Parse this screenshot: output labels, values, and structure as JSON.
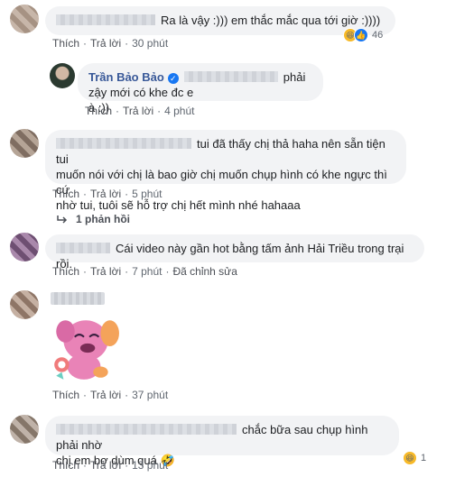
{
  "actions": {
    "like": "Thích",
    "reply": "Trả lời",
    "edited": "Đã chỉnh sửa"
  },
  "comments": [
    {
      "text": "Ra là vậy :))) em thắc mắc qua tới giờ :))))",
      "time": "30 phút",
      "reaction_count": "46"
    },
    {
      "author": "Trần Bảo Bảo",
      "text_line1": "phải zậy mới có khe đc e",
      "text_line2": "à :))",
      "time": "4 phút"
    },
    {
      "text_line1": "tui đã thấy chị thả haha nên sẵn tiện tui",
      "text_line2": "muốn nói với chị là bao giờ chị muốn chụp hình có khe ngực thì cứ",
      "text_line3": "nhờ tui, tuôi sẽ hỗ trợ chị hết mình nhé hahaaa",
      "time": "5 phút",
      "replies": "1 phản hồi"
    },
    {
      "text": "Cái video này gần hot bằng tấm ảnh Hải Triều trong trại rồi.",
      "time": "7 phút"
    },
    {
      "time": "37 phút"
    },
    {
      "text_line1": "chắc bữa sau chụp hình phải nhờ",
      "text_line2": "chị em bợ dùm quá 🤣",
      "time": "13 phút",
      "reaction_count": "1"
    }
  ],
  "colors": {
    "link": "#385898",
    "bubble": "#f2f3f5",
    "meta": "#606770"
  },
  "icons": [
    "haha-icon",
    "like-icon",
    "verified-icon",
    "reply-arrow-icon",
    "sticker-icon"
  ]
}
